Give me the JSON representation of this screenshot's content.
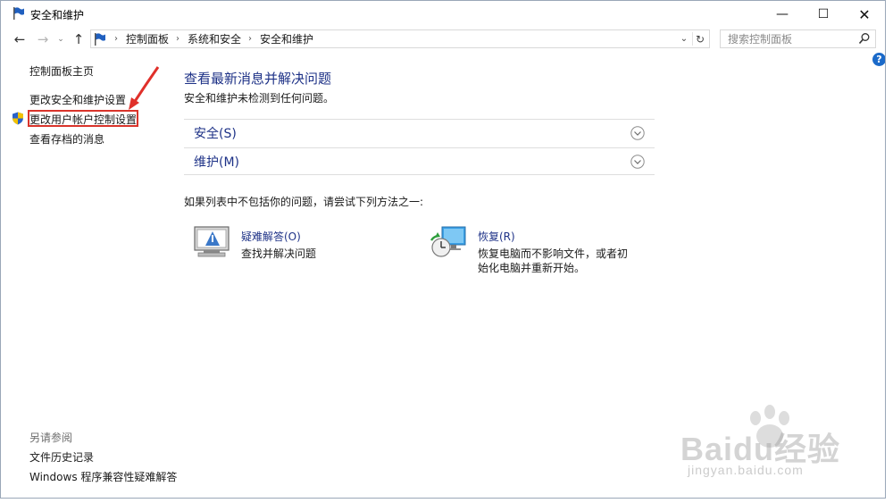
{
  "window": {
    "title": "安全和维护",
    "minimize_symbol": "—",
    "maximize_symbol": "☐",
    "close_symbol": "✕"
  },
  "nav": {
    "back_symbol": "←",
    "forward_symbol": "→",
    "recent_symbol": "⌄",
    "up_symbol": "↑"
  },
  "address": {
    "separator": "›",
    "breadcrumbs": [
      "控制面板",
      "系统和安全",
      "安全和维护"
    ],
    "dropdown_symbol": "⌄",
    "refresh_symbol": "↻"
  },
  "search": {
    "placeholder": "搜索控制面板"
  },
  "help": {
    "label": "?"
  },
  "sidebar": {
    "home": "控制面板主页",
    "links": [
      "更改安全和维护设置",
      "更改用户帐户控制设置",
      "查看存档的消息"
    ],
    "see_also_title": "另请参阅",
    "see_also": [
      "文件历史记录",
      "Windows 程序兼容性疑难解答"
    ]
  },
  "main": {
    "title": "查看最新消息并解决问题",
    "subtitle": "安全和维护未检测到任何问题。",
    "sections": [
      "安全(S)",
      "维护(M)"
    ],
    "hint": "如果列表中不包括你的问题，请尝试下列方法之一:",
    "tools": [
      {
        "title": "疑难解答(O)",
        "desc": "查找并解决问题"
      },
      {
        "title": "恢复(R)",
        "desc": "恢复电脑而不影响文件，或者初始化电脑并重新开始。"
      }
    ]
  },
  "watermark": {
    "brand": "Baidu经验",
    "sub": "jingyan.baidu.com"
  },
  "colors": {
    "link_blue": "#1e3287",
    "highlight_red": "#d9342b",
    "help_blue": "#1b6ac9"
  }
}
